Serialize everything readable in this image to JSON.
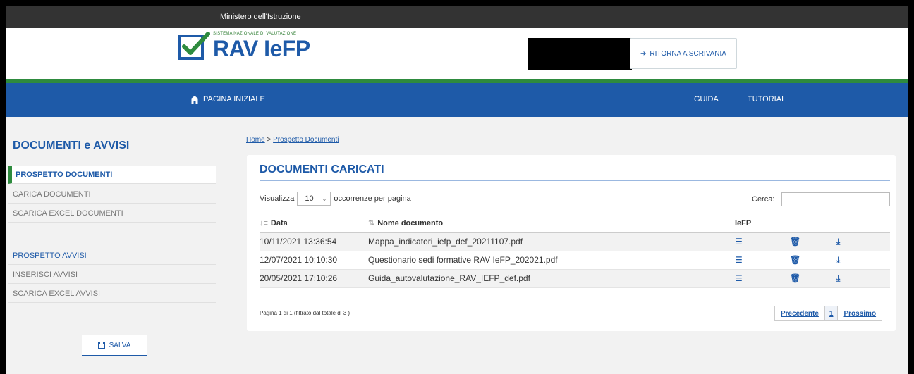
{
  "topbar": {
    "title": "Ministero dell'Istruzione"
  },
  "logo": {
    "small_text": "SISTEMA NAZIONALE DI VALUTAZIONE",
    "big_text": "RAV IeFP"
  },
  "header": {
    "ritorna_label": "RITORNA A SCRIVANIA"
  },
  "nav": {
    "home_label": "PAGINA INIZIALE",
    "guida_label": "GUIDA",
    "tutorial_label": "TUTORIAL"
  },
  "sidebar": {
    "title": "DOCUMENTI e AVVISI",
    "items": [
      {
        "label": "PROSPETTO DOCUMENTI"
      },
      {
        "label": "CARICA DOCUMENTI"
      },
      {
        "label": "SCARICA EXCEL DOCUMENTI"
      },
      {
        "label": "PROSPETTO AVVISI"
      },
      {
        "label": "INSERISCI AVVISI"
      },
      {
        "label": "SCARICA EXCEL AVVISI"
      }
    ],
    "save_label": "SALVA"
  },
  "breadcrumb": {
    "home": "Home",
    "sep": ">",
    "current": "Prospetto Documenti"
  },
  "card": {
    "title": "DOCUMENTI CARICATI",
    "show_label": "Visualizza",
    "page_size": "10",
    "per_page_label": "occorrenze per pagina",
    "search_label": "Cerca:",
    "columns": {
      "data": "Data",
      "nome": "Nome documento",
      "iefp": "IeFP"
    },
    "rows": [
      {
        "data": "10/11/2021 13:36:54",
        "nome": "Mappa_indicatori_iefp_def_20211107.pdf"
      },
      {
        "data": "12/07/2021 10:10:30",
        "nome": "Questionario sedi formative RAV IeFP_202021.pdf"
      },
      {
        "data": "20/05/2021 17:10:26",
        "nome": "Guida_autovalutazione_RAV_IEFP_def.pdf"
      }
    ],
    "page_info": "Pagina 1 di 1 (filtrato dal totale di 3 )",
    "pager": {
      "prev": "Precedente",
      "current": "1",
      "next": "Prossimo"
    }
  },
  "colors": {
    "primary": "#1e5aa8",
    "green": "#2e8b3e",
    "topbar": "#333333"
  }
}
